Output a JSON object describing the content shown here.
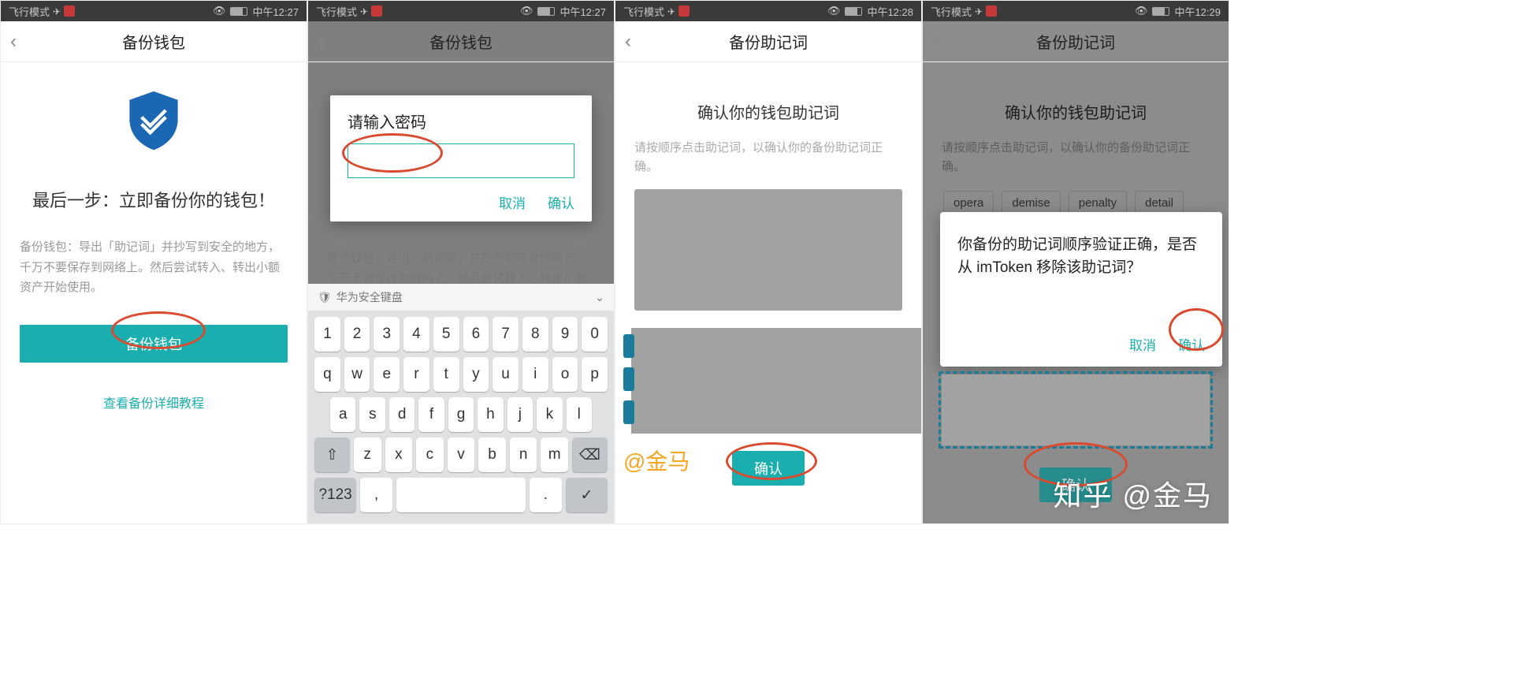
{
  "status": {
    "flight_mode": "飞行模式",
    "time1": "中午12:27",
    "time2": "中午12:27",
    "time3": "中午12:28",
    "time4": "中午12:29"
  },
  "screens": {
    "s1": {
      "title": "备份钱包",
      "heading": "最后一步：立即备份你的钱包！",
      "desc": "备份钱包：导出「助记词」并抄写到安全的地方，千万不要保存到网络上。然后尝试转入、转出小额资产开始使用。",
      "btn": "备份钱包",
      "link": "查看备份详细教程"
    },
    "s2": {
      "title": "备份钱包",
      "desc": "备份钱包：导出「助记词」并抄写到安全的地方，千万不要保存到网络上。然后尝试转入、转出小额资产开始使用。",
      "dialog_title": "请输入密码",
      "cancel": "取消",
      "confirm": "确认",
      "kb_label": "华为安全键盘",
      "kb_rows": [
        [
          "1",
          "2",
          "3",
          "4",
          "5",
          "6",
          "7",
          "8",
          "9",
          "0"
        ],
        [
          "q",
          "w",
          "e",
          "r",
          "t",
          "y",
          "u",
          "i",
          "o",
          "p"
        ],
        [
          "a",
          "s",
          "d",
          "f",
          "g",
          "h",
          "j",
          "k",
          "l"
        ],
        [
          "⇧",
          "z",
          "x",
          "c",
          "v",
          "b",
          "n",
          "m",
          "⌫"
        ],
        [
          "?123",
          ",",
          "",
          "",
          ".",
          "✓"
        ]
      ]
    },
    "s3": {
      "title": "备份助记词",
      "sub": "确认你的钱包助记词",
      "desc": "请按顺序点击助记词，以确认你的备份助记词正确。",
      "confirm": "确认",
      "watermark": "@金马"
    },
    "s4": {
      "title": "备份助记词",
      "sub": "确认你的钱包助记词",
      "desc": "请按顺序点击助记词，以确认你的备份助记词正确。",
      "words": [
        "opera",
        "demise",
        "penalty",
        "detail"
      ],
      "dialog_body": "你备份的助记词顺序验证正确，是否从 imToken 移除该助记词？",
      "cancel": "取消",
      "confirm": "确认",
      "confirm_btn": "确认"
    }
  },
  "watermark_zhihu": "知乎 @金马"
}
